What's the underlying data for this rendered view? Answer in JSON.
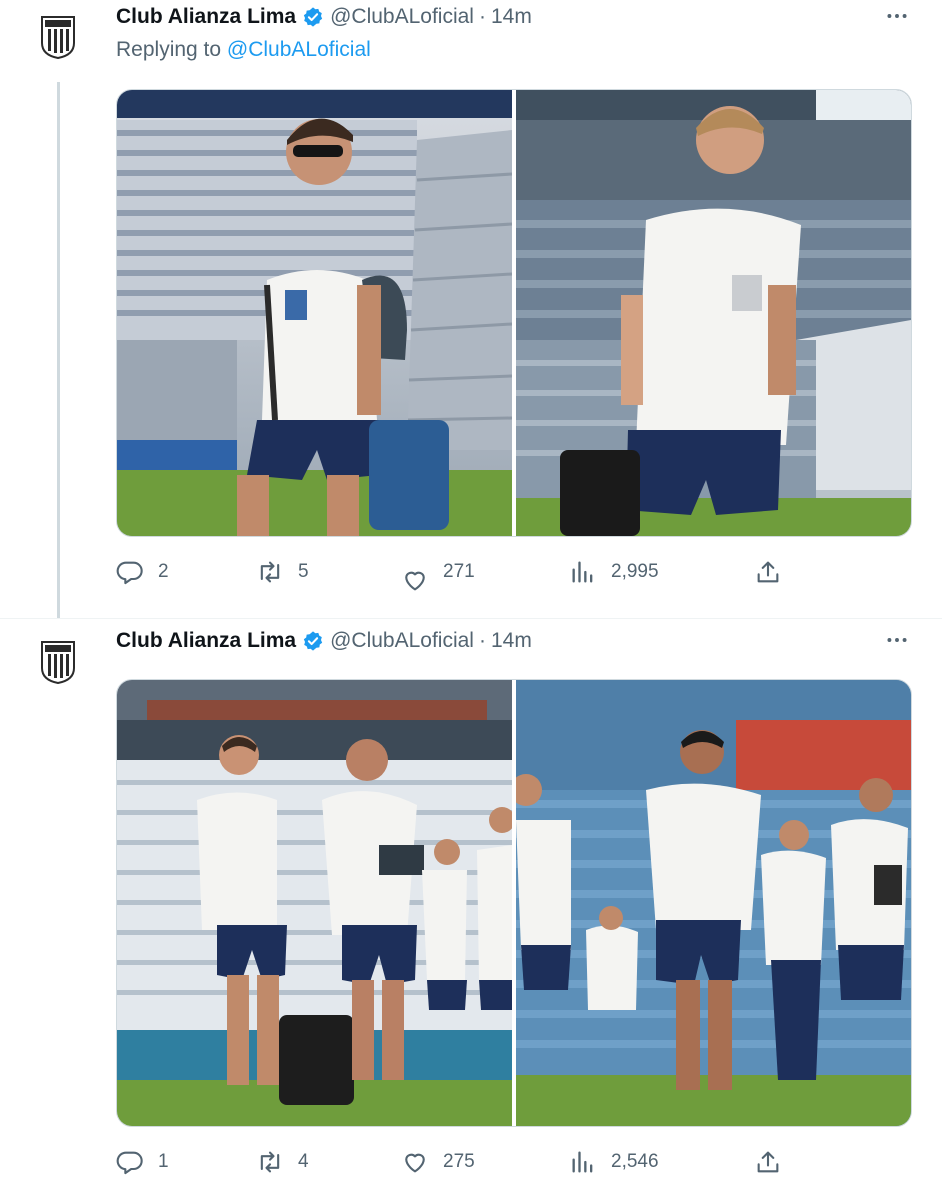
{
  "tweets": [
    {
      "author_name": "Club Alianza Lima",
      "handle": "@ClubALoficial",
      "separator": "·",
      "time": "14m",
      "replying_prefix": "Replying to ",
      "replying_to": "@ClubALoficial",
      "replies": "2",
      "retweets": "5",
      "likes": "271",
      "views": "2,995"
    },
    {
      "author_name": "Club Alianza Lima",
      "handle": "@ClubALoficial",
      "separator": "·",
      "time": "14m",
      "replies": "1",
      "retweets": "4",
      "likes": "275",
      "views": "2,546"
    }
  ],
  "colors": {
    "accent": "#1d9bf0",
    "secondary_text": "#536471",
    "kit_white": "#f4f4f2",
    "kit_navy": "#1d2f5a",
    "pitch_green": "#6f9d3c",
    "stands_blue": "#4f7fa8"
  },
  "icons": [
    "club-crest-icon",
    "verified-badge-icon",
    "more-icon",
    "reply-icon",
    "retweet-icon",
    "like-icon",
    "views-icon",
    "share-icon"
  ]
}
